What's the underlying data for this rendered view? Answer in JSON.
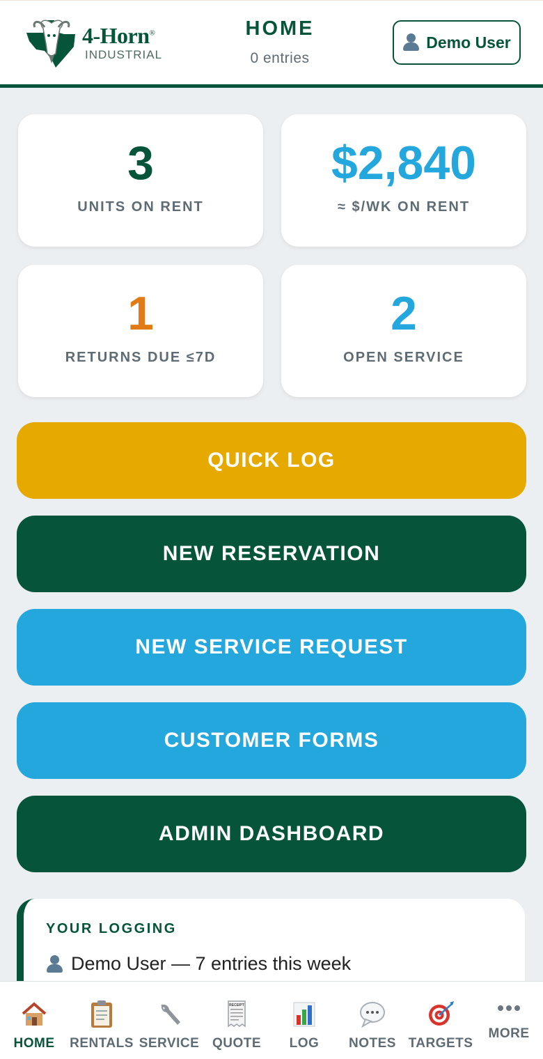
{
  "header": {
    "brand_name": "4-Horn",
    "brand_sub": "INDUSTRIAL",
    "title": "HOME",
    "subtitle": "0 entries",
    "user_label": "Demo User",
    "colors": {
      "brand_green": "#06553b"
    }
  },
  "stats": [
    {
      "value": "3",
      "label": "UNITS ON RENT",
      "color": "#06553b"
    },
    {
      "value": "$2,840",
      "label": "≈ $/WK ON RENT",
      "color": "#23a7dc"
    },
    {
      "value": "1",
      "label": "RETURNS DUE ≤7D",
      "color": "#e07b15"
    },
    {
      "value": "2",
      "label": "OPEN SERVICE",
      "color": "#23a7dc"
    }
  ],
  "actions": [
    {
      "label": "QUICK LOG",
      "color": "#e6a900"
    },
    {
      "label": "NEW RESERVATION",
      "color": "#06553b"
    },
    {
      "label": "NEW SERVICE REQUEST",
      "color": "#23a7dc"
    },
    {
      "label": "CUSTOMER FORMS",
      "color": "#23a7dc"
    },
    {
      "label": "ADMIN DASHBOARD",
      "color": "#06553b"
    }
  ],
  "logging": {
    "title": "YOUR LOGGING",
    "line": "Demo User — 7 entries this week"
  },
  "nav": {
    "items": [
      {
        "label": "HOME",
        "icon": "house-icon",
        "active": true
      },
      {
        "label": "RENTALS",
        "icon": "clipboard-icon"
      },
      {
        "label": "SERVICE",
        "icon": "wrench-icon"
      },
      {
        "label": "QUOTE",
        "icon": "receipt-icon",
        "icon_text": "RECEIPT"
      },
      {
        "label": "LOG",
        "icon": "bar-chart-icon"
      },
      {
        "label": "NOTES",
        "icon": "speech-bubble-icon"
      },
      {
        "label": "TARGETS",
        "icon": "target-icon"
      },
      {
        "label": "MORE",
        "icon": "more-dots-icon"
      }
    ]
  }
}
